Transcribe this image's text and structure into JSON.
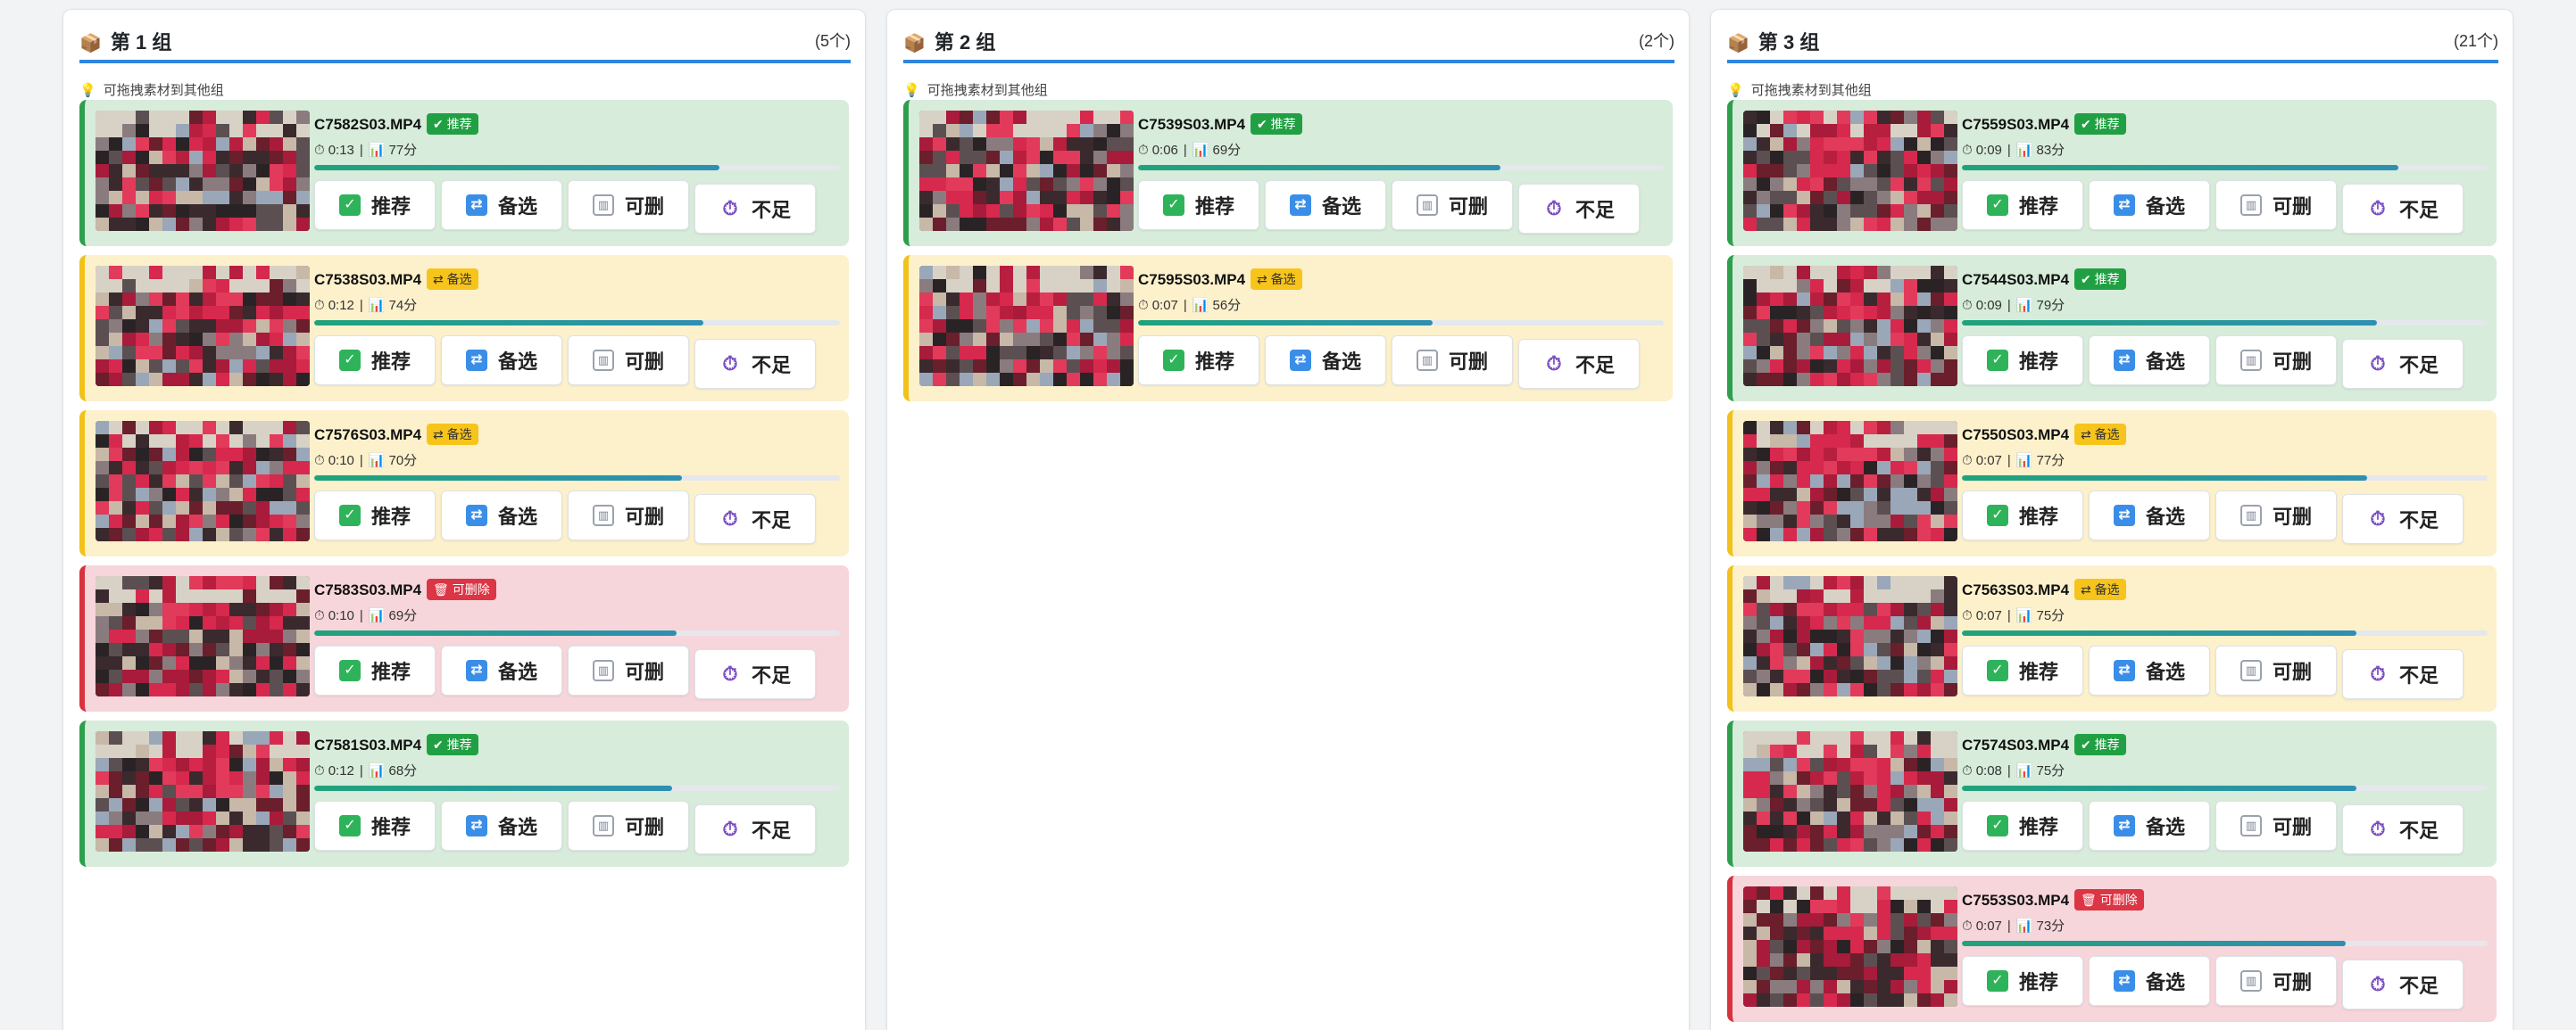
{
  "hint": "可拖拽素材到其他组",
  "buttons": {
    "recommend": "推荐",
    "alternate": "备选",
    "deletable": "可删",
    "insufficient": "不足"
  },
  "badges": {
    "recommend": "推荐",
    "alternate": "备选",
    "deletable": "可删除"
  },
  "icons": {
    "group": "package-icon",
    "hint": "lightbulb-icon",
    "duration": "stopwatch-icon",
    "score": "bar-chart-icon",
    "recommend": "check-box-icon",
    "alternate": "swap-icon",
    "deletable": "wastebasket-icon",
    "insufficient": "stopwatch-icon"
  },
  "colors": {
    "accent": "#2f86dd",
    "recommend_bg": "#d7ecda",
    "recommend_border": "#2e9f4c",
    "alternate_bg": "#fdf1cc",
    "alternate_border": "#f2c21b",
    "delete_bg": "#f6d6da",
    "delete_border": "#d9323f"
  },
  "groups": [
    {
      "title": "第 1 组",
      "count": "(5个)",
      "clips": [
        {
          "file": "C7582S03.MP4",
          "status": "recommend",
          "badge": "推荐",
          "duration": "0:13",
          "score": "77分",
          "score_value": 77
        },
        {
          "file": "C7538S03.MP4",
          "status": "alternate",
          "badge": "备选",
          "duration": "0:12",
          "score": "74分",
          "score_value": 74
        },
        {
          "file": "C7576S03.MP4",
          "status": "alternate",
          "badge": "备选",
          "duration": "0:10",
          "score": "70分",
          "score_value": 70
        },
        {
          "file": "C7583S03.MP4",
          "status": "delete",
          "badge": "可删除",
          "duration": "0:10",
          "score": "69分",
          "score_value": 69
        },
        {
          "file": "C7581S03.MP4",
          "status": "recommend",
          "badge": "推荐",
          "duration": "0:12",
          "score": "68分",
          "score_value": 68
        }
      ]
    },
    {
      "title": "第 2 组",
      "count": "(2个)",
      "clips": [
        {
          "file": "C7539S03.MP4",
          "status": "recommend",
          "badge": "推荐",
          "duration": "0:06",
          "score": "69分",
          "score_value": 69
        },
        {
          "file": "C7595S03.MP4",
          "status": "alternate",
          "badge": "备选",
          "duration": "0:07",
          "score": "56分",
          "score_value": 56
        }
      ]
    },
    {
      "title": "第 3 组",
      "count": "(21个)",
      "clips": [
        {
          "file": "C7559S03.MP4",
          "status": "recommend",
          "badge": "推荐",
          "duration": "0:09",
          "score": "83分",
          "score_value": 83
        },
        {
          "file": "C7544S03.MP4",
          "status": "recommend",
          "badge": "推荐",
          "duration": "0:09",
          "score": "79分",
          "score_value": 79
        },
        {
          "file": "C7550S03.MP4",
          "status": "alternate",
          "badge": "备选",
          "duration": "0:07",
          "score": "77分",
          "score_value": 77
        },
        {
          "file": "C7563S03.MP4",
          "status": "alternate",
          "badge": "备选",
          "duration": "0:07",
          "score": "75分",
          "score_value": 75
        },
        {
          "file": "C7574S03.MP4",
          "status": "recommend",
          "badge": "推荐",
          "duration": "0:08",
          "score": "75分",
          "score_value": 75
        },
        {
          "file": "C7553S03.MP4",
          "status": "delete",
          "badge": "可删除",
          "duration": "0:07",
          "score": "73分",
          "score_value": 73
        }
      ]
    }
  ]
}
